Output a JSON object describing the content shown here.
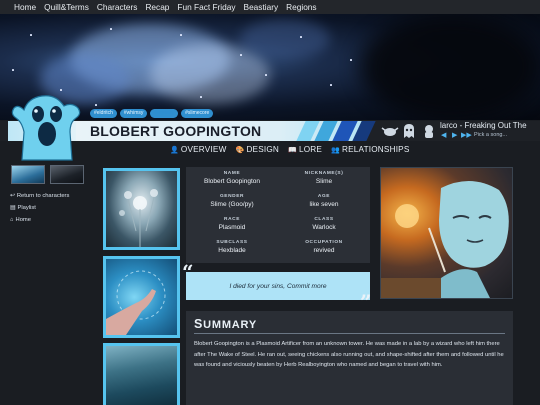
{
  "nav": [
    "Home",
    "Quill&Terms",
    "Characters",
    "Recap",
    "Fun Fact Friday",
    "Beastiary",
    "Regions"
  ],
  "tags": [
    "#eldritch",
    "#whimsy",
    "#squishy",
    "#slimecore"
  ],
  "character": {
    "name": "BLOBERT GOOPINGTON"
  },
  "player": {
    "title": "larco - Freaking Out The",
    "placeholder": "Pick a song...",
    "controls": [
      "◀",
      "▶",
      "▶▶"
    ]
  },
  "tabs": [
    {
      "icon": "user-icon",
      "glyph": "👤",
      "label": "OVERVIEW"
    },
    {
      "icon": "palette-icon",
      "glyph": "🎨",
      "label": "DESIGN"
    },
    {
      "icon": "book-icon",
      "glyph": "📖",
      "label": "LORE"
    },
    {
      "icon": "people-icon",
      "glyph": "👥",
      "label": "RELATIONSHIPS"
    }
  ],
  "sidebar": [
    {
      "icon": "back-arrow-icon",
      "glyph": "↩",
      "label": "Return to characters"
    },
    {
      "icon": "playlist-icon",
      "glyph": "▤",
      "label": "Playlist"
    },
    {
      "icon": "home-icon",
      "glyph": "⌂",
      "label": "Home"
    }
  ],
  "info": {
    "name": {
      "label": "NAME",
      "value": "Blobert Goopington"
    },
    "nicknames": {
      "label": "NICKNAME(S)",
      "value": "Slime"
    },
    "gender": {
      "label": "GENDER",
      "value": "Slime (Goo/py)"
    },
    "age": {
      "label": "AGE",
      "value": "like seven"
    },
    "race": {
      "label": "RACE",
      "value": "Plasmoid"
    },
    "class": {
      "label": "CLASS",
      "value": "Warlock"
    },
    "subclass": {
      "label": "SUBCLASS",
      "value": "Hexblade"
    },
    "occupation": {
      "label": "OCCUPATION",
      "value": "revived"
    }
  },
  "quote": "I died for your sins, Commit more",
  "summary": {
    "title_first": "S",
    "title_rest": "UMMARY",
    "text": "Blobert Goopington is a Plasmoid Artificer from an unknown tower. He was made in a lab by a wizard who left him there after The Wake of Steel. He ran out, seeing chickens also running out, and shape-shifted after them and followed until he was found and viciously beaten by Herb Realboyington who named and began to travel with him."
  },
  "colors": {
    "accent": "#56c4ef",
    "tag": "#2f8fd0",
    "quote_bg": "#aee3f7",
    "panel": "#2b2f36",
    "ghost": "#6fd0ee"
  }
}
